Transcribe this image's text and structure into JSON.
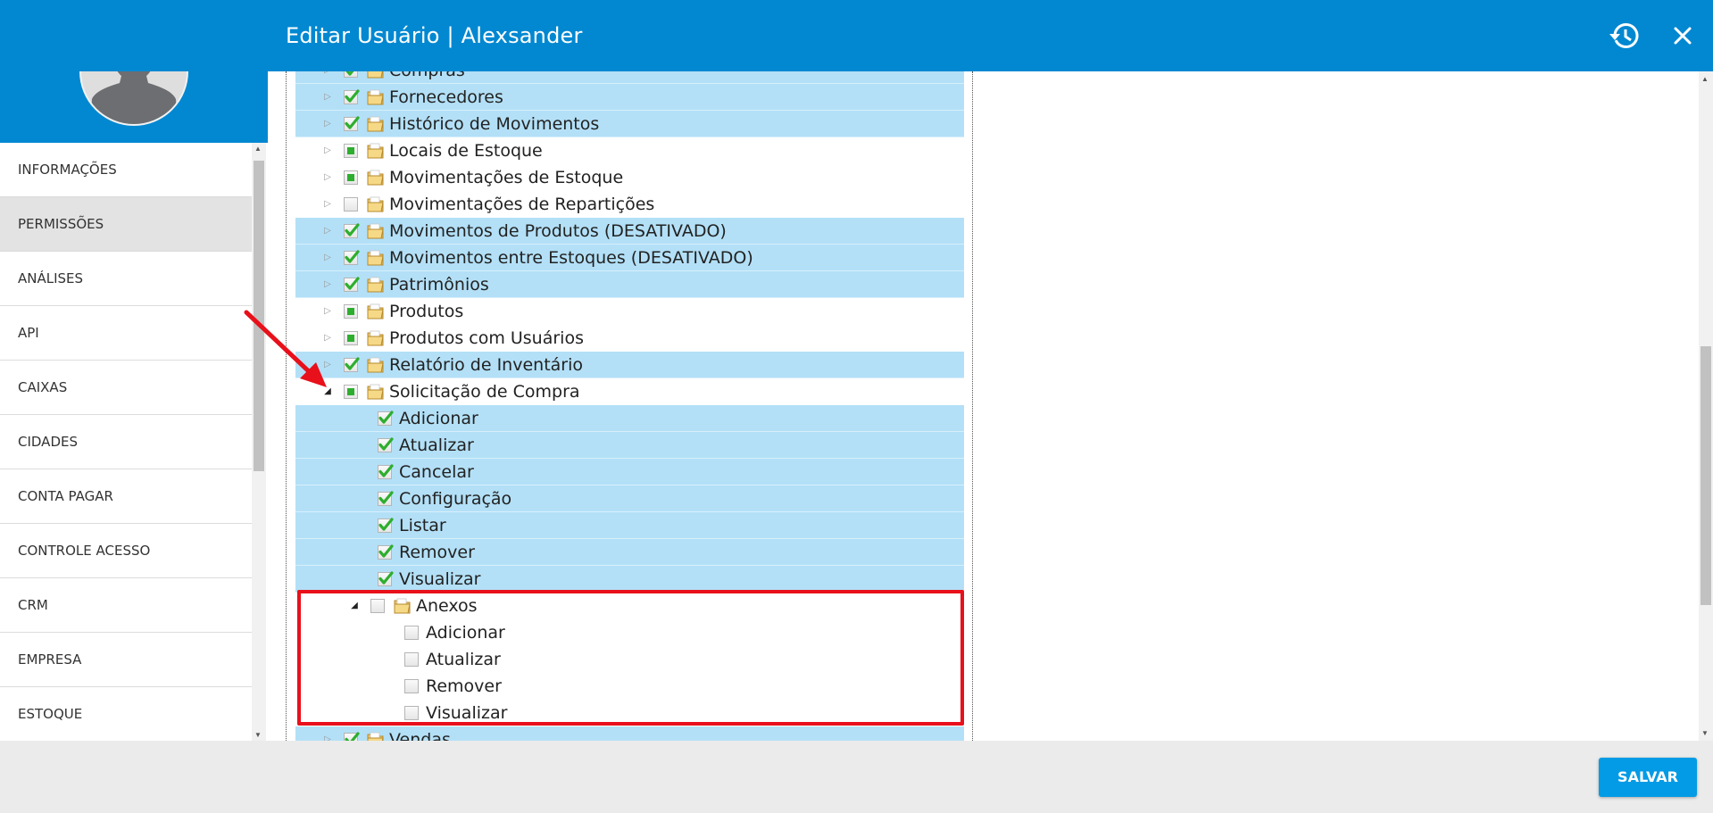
{
  "header": {
    "title": "Editar Usuário | Alexsander",
    "history_icon": "history-icon",
    "close_icon": "close-icon"
  },
  "sidebar": {
    "items": [
      {
        "label": "INFORMAÇÕES",
        "active": false
      },
      {
        "label": "PERMISSÕES",
        "active": true
      },
      {
        "label": "ANÁLISES",
        "active": false
      },
      {
        "label": "API",
        "active": false
      },
      {
        "label": "CAIXAS",
        "active": false
      },
      {
        "label": "CIDADES",
        "active": false
      },
      {
        "label": "CONTA PAGAR",
        "active": false
      },
      {
        "label": "CONTROLE ACESSO",
        "active": false
      },
      {
        "label": "CRM",
        "active": false
      },
      {
        "label": "EMPRESA",
        "active": false
      },
      {
        "label": "ESTOQUE",
        "active": false
      }
    ]
  },
  "tree": {
    "rows": [
      {
        "label": "Compras",
        "level": 0,
        "state": "checked",
        "expanded": false,
        "folder": true,
        "highlight": true
      },
      {
        "label": "Fornecedores",
        "level": 0,
        "state": "checked",
        "expanded": false,
        "folder": true,
        "highlight": true
      },
      {
        "label": "Histórico de Movimentos",
        "level": 0,
        "state": "checked",
        "expanded": false,
        "folder": true,
        "highlight": true
      },
      {
        "label": "Locais de Estoque",
        "level": 0,
        "state": "partial",
        "expanded": false,
        "folder": true,
        "highlight": false
      },
      {
        "label": "Movimentações de Estoque",
        "level": 0,
        "state": "partial",
        "expanded": false,
        "folder": true,
        "highlight": false
      },
      {
        "label": "Movimentações de Repartições",
        "level": 0,
        "state": "unchecked",
        "expanded": false,
        "folder": true,
        "highlight": false
      },
      {
        "label": "Movimentos de Produtos (DESATIVADO)",
        "level": 0,
        "state": "checked",
        "expanded": false,
        "folder": true,
        "highlight": true
      },
      {
        "label": "Movimentos entre Estoques (DESATIVADO)",
        "level": 0,
        "state": "checked",
        "expanded": false,
        "folder": true,
        "highlight": true
      },
      {
        "label": "Patrimônios",
        "level": 0,
        "state": "checked",
        "expanded": false,
        "folder": true,
        "highlight": true
      },
      {
        "label": "Produtos",
        "level": 0,
        "state": "partial",
        "expanded": false,
        "folder": true,
        "highlight": false
      },
      {
        "label": "Produtos com Usuários",
        "level": 0,
        "state": "partial",
        "expanded": false,
        "folder": true,
        "highlight": false
      },
      {
        "label": "Relatório de Inventário",
        "level": 0,
        "state": "checked",
        "expanded": false,
        "folder": true,
        "highlight": true
      },
      {
        "label": "Solicitação de Compra",
        "level": 0,
        "state": "partial",
        "expanded": true,
        "folder": true,
        "highlight": false
      },
      {
        "label": "Adicionar",
        "level": 1,
        "state": "checked",
        "leaf": true,
        "highlight": true
      },
      {
        "label": "Atualizar",
        "level": 1,
        "state": "checked",
        "leaf": true,
        "highlight": true
      },
      {
        "label": "Cancelar",
        "level": 1,
        "state": "checked",
        "leaf": true,
        "highlight": true
      },
      {
        "label": "Configuração",
        "level": 1,
        "state": "checked",
        "leaf": true,
        "highlight": true
      },
      {
        "label": "Listar",
        "level": 1,
        "state": "checked",
        "leaf": true,
        "highlight": true
      },
      {
        "label": "Remover",
        "level": 1,
        "state": "checked",
        "leaf": true,
        "highlight": true
      },
      {
        "label": "Visualizar",
        "level": 1,
        "state": "checked",
        "leaf": true,
        "highlight": true
      },
      {
        "label": "Anexos",
        "level": 1,
        "state": "unchecked",
        "expanded": true,
        "folder": true,
        "highlight": false
      },
      {
        "label": "Adicionar",
        "level": 2,
        "state": "unchecked",
        "leaf": true,
        "highlight": false
      },
      {
        "label": "Atualizar",
        "level": 2,
        "state": "unchecked",
        "leaf": true,
        "highlight": false
      },
      {
        "label": "Remover",
        "level": 2,
        "state": "unchecked",
        "leaf": true,
        "highlight": false
      },
      {
        "label": "Visualizar",
        "level": 2,
        "state": "unchecked",
        "leaf": true,
        "highlight": false
      },
      {
        "label": "Vendas",
        "level": 0,
        "state": "checked",
        "expanded": false,
        "folder": true,
        "highlight": true
      }
    ]
  },
  "footer": {
    "save_label": "SALVAR"
  },
  "colors": {
    "primary": "#0288d1",
    "save_button": "#039be5",
    "row_highlight": "#b3e0f7",
    "annotation_red": "#e8101a",
    "check_green": "#2eae2e"
  }
}
